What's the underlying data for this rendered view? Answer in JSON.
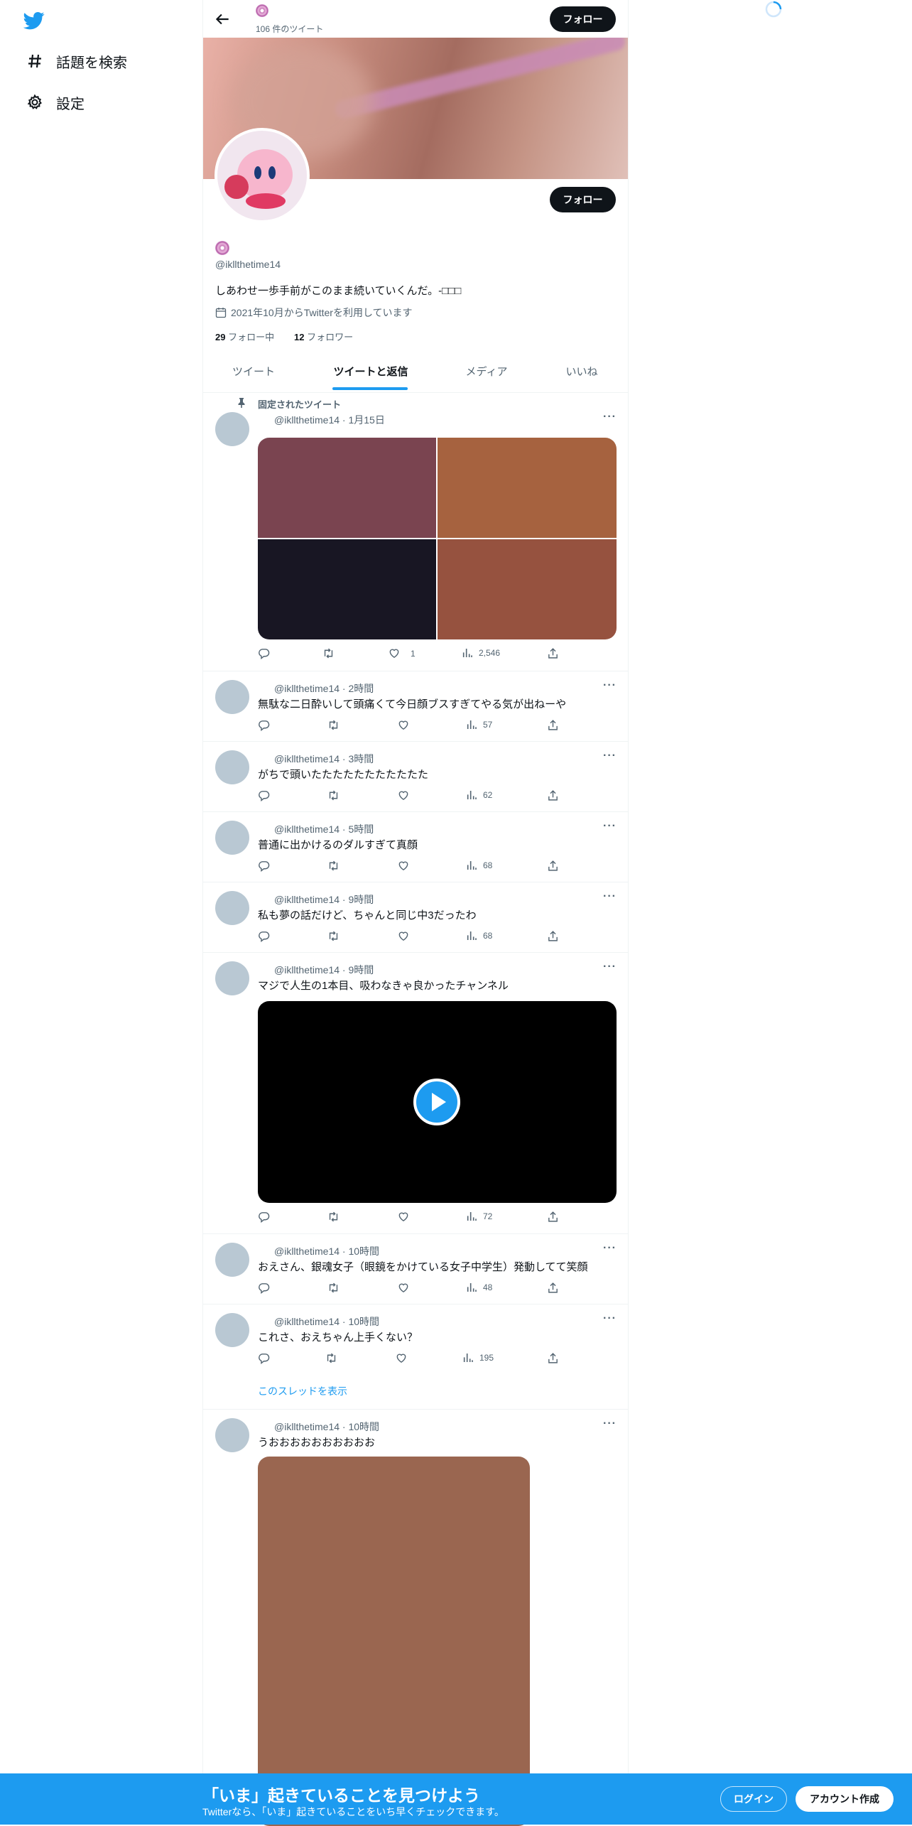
{
  "nav": {
    "explore_label": "話題を検索",
    "settings_label": "設定"
  },
  "header": {
    "tweet_count": "106 件のツイート",
    "follow_label": "フォロー"
  },
  "profile": {
    "handle": "@ikllthetime14",
    "bio": "しあわせ一歩手前がこのまま続いていくんだ。-□□□",
    "joined": "2021年10月からTwitterを利用しています",
    "following_count": "29",
    "following_label": "フォロー中",
    "followers_count": "12",
    "followers_label": "フォロワー",
    "follow_label": "フォロー"
  },
  "tabs": [
    {
      "label": "ツイート"
    },
    {
      "label": "ツイートと返信"
    },
    {
      "label": "メディア"
    },
    {
      "label": "いいね"
    }
  ],
  "tweets": [
    {
      "pinned_label": "固定されたツイート",
      "meta": "@ikllthetime14 · 1月15日",
      "text": "",
      "likes": "1",
      "views": "2,546"
    },
    {
      "meta": "@ikllthetime14 · 2時間",
      "text": "無駄な二日酔いして頭痛くて今日顔ブスすぎてやる気が出ねーや",
      "views": "57"
    },
    {
      "meta": "@ikllthetime14 · 3時間",
      "text": "がちで頭いたたたたたたたたたたた",
      "views": "62"
    },
    {
      "meta": "@ikllthetime14 · 5時間",
      "text": "普通に出かけるのダルすぎて真顔",
      "views": "68"
    },
    {
      "meta": "@ikllthetime14 · 9時間",
      "text": "私も夢の話だけど、ちゃんと同じ中3だったわ",
      "views": "68"
    },
    {
      "meta": "@ikllthetime14 · 9時間",
      "text": "マジで人生の1本目、吸わなきゃ良かったチャンネル",
      "views": "72"
    },
    {
      "meta": "@ikllthetime14 · 10時間",
      "text": "おえさん、銀魂女子（眼鏡をかけている女子中学生）発動してて笑顔",
      "views": "48"
    },
    {
      "meta": "@ikllthetime14 · 10時間",
      "text": "これさ、おえちゃん上手くない？",
      "views": "195",
      "thread_link": "このスレッドを表示"
    },
    {
      "meta": "@ikllthetime14 · 10時間",
      "text": "うおおおおおおおおおお"
    }
  ],
  "banner": {
    "title": "「いま」起きていることを見つけよう",
    "subtitle": "Twitterなら、「いま」起きていることをいち早くチェックできます。",
    "login_label": "ログイン",
    "signup_label": "アカウント作成"
  },
  "colors": {
    "accent": "#1d9bf0",
    "text": "#0f1419",
    "secondary": "#536471",
    "tile_1": "#7a4450",
    "tile_2": "#a6623f",
    "tile_3": "#181623",
    "tile_4": "#96523f",
    "photo": "#9a6650"
  }
}
